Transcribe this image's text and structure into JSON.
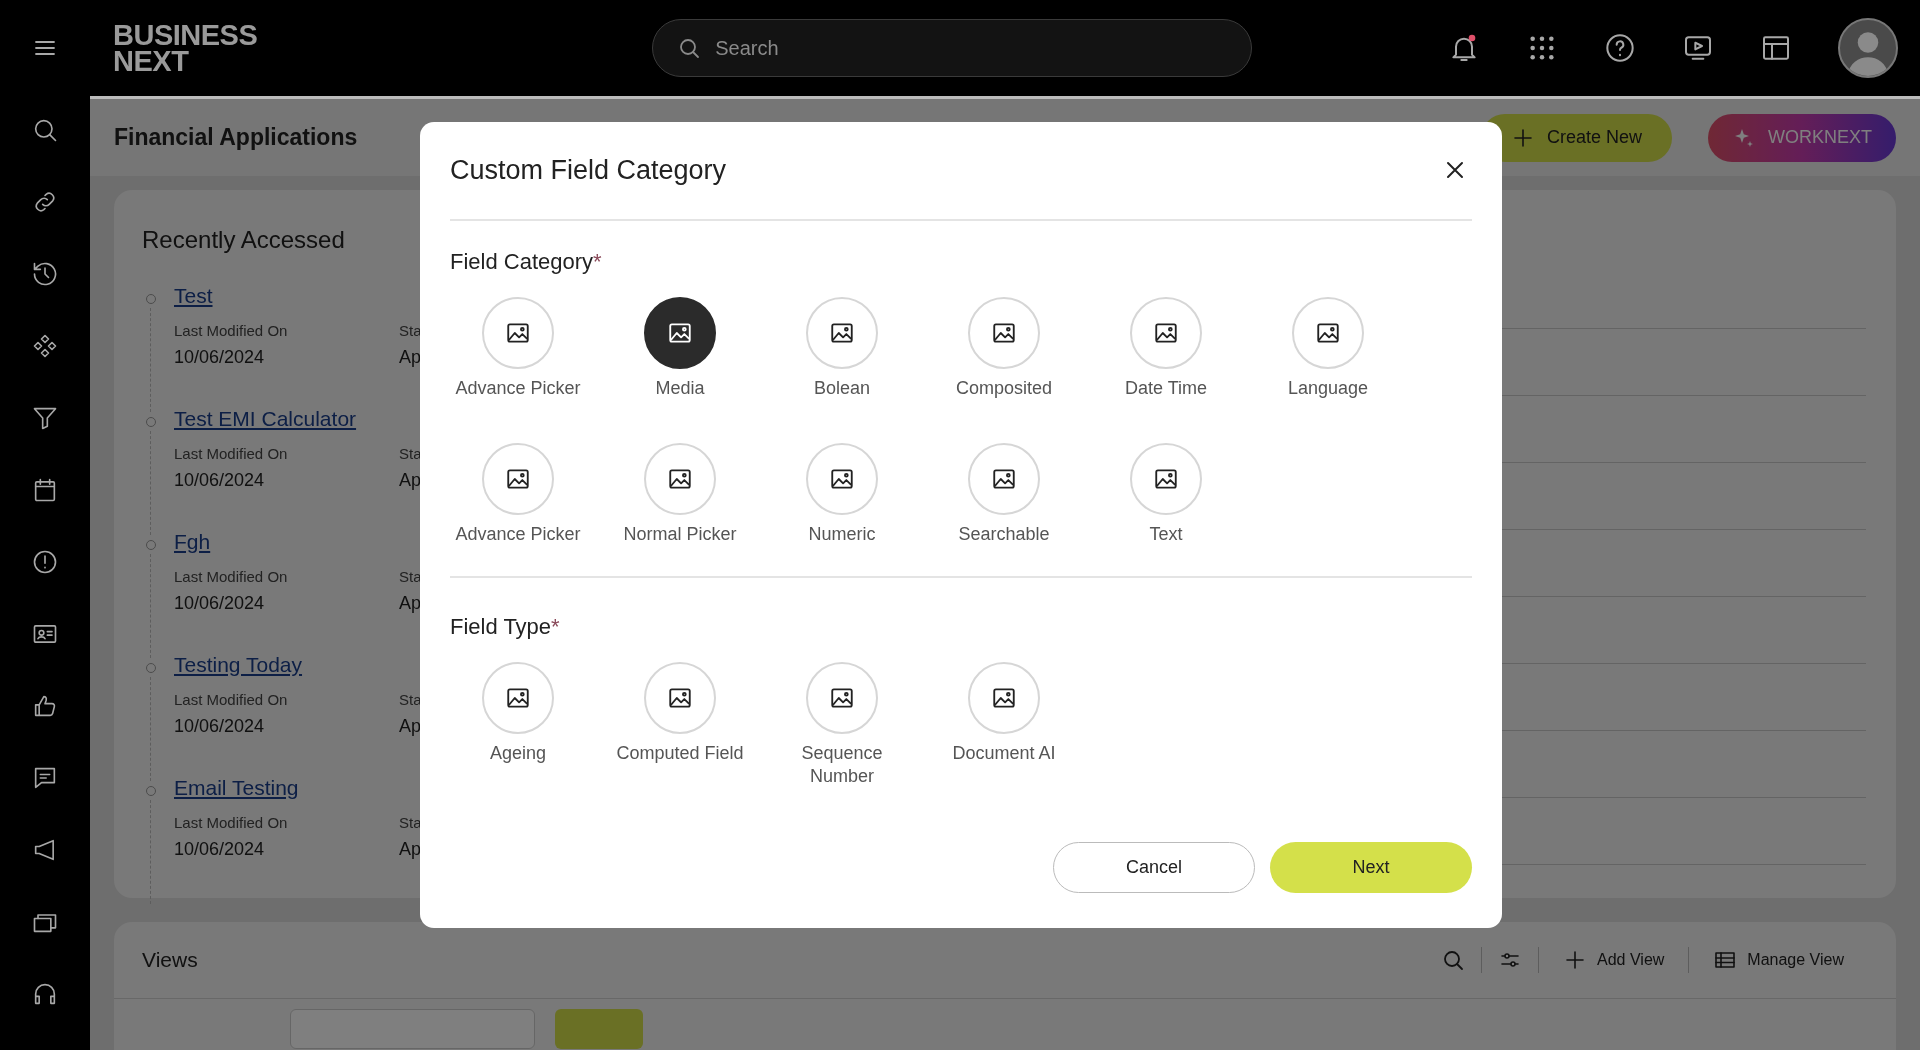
{
  "topbar": {
    "logo": [
      "BUSINESS",
      "NEXT"
    ],
    "search": {
      "placeholder": "Search"
    }
  },
  "page": {
    "title": "Financial Applications",
    "actions": [
      {
        "label": "Create New",
        "kind": "create"
      },
      {
        "label": "WORKNEXT",
        "kind": "ai"
      }
    ]
  },
  "recently_accessed": {
    "title": "Recently Accessed",
    "items": [
      {
        "name": "Test",
        "label": "Last Modified On",
        "date": "10/06/2024",
        "column_2_label": "Sta",
        "column_2_value": "Ap"
      },
      {
        "name": "Test EMI Calculator",
        "label": "Last Modified On",
        "date": "10/06/2024",
        "column_2_label": "Sta",
        "column_2_value": "Ap"
      },
      {
        "name": "Fgh",
        "label": "Last Modified On",
        "date": "10/06/2024",
        "column_2_label": "Sta",
        "column_2_value": "Ap"
      },
      {
        "name": "Testing Today",
        "label": "Last Modified On",
        "date": "10/06/2024",
        "column_2_label": "Sta",
        "column_2_value": "Ap"
      },
      {
        "name": "Email Testing",
        "label": "Last Modified On",
        "date": "10/06/2024",
        "column_2_label": "Sta",
        "column_2_value": "Ap"
      }
    ]
  },
  "views": {
    "title": "Views",
    "actions": [
      {
        "label": "Add View",
        "kind": "add"
      },
      {
        "label": "Manage View",
        "kind": "manage"
      }
    ]
  },
  "dialog": {
    "title": "Custom Field Category",
    "sections": [
      {
        "title": "Field Category",
        "required_mark": "*",
        "options": [
          {
            "label": "Advance Picker",
            "selected": false
          },
          {
            "label": "Media",
            "selected": true
          },
          {
            "label": "Bolean",
            "selected": false
          },
          {
            "label": "Composited",
            "selected": false
          },
          {
            "label": "Date Time",
            "selected": false
          },
          {
            "label": "Language",
            "selected": false
          },
          {
            "label": "Advance Picker",
            "selected": false
          },
          {
            "label": "Normal Picker",
            "selected": false
          },
          {
            "label": "Numeric",
            "selected": false
          },
          {
            "label": "Searchable",
            "selected": false
          },
          {
            "label": "Text",
            "selected": false
          }
        ]
      },
      {
        "title": "Field Type",
        "required_mark": "*",
        "options": [
          {
            "label": "Ageing",
            "selected": false
          },
          {
            "label": "Computed Field",
            "selected": false
          },
          {
            "label": "Sequence Number",
            "selected": false
          },
          {
            "label": "Document AI",
            "selected": false
          }
        ]
      }
    ],
    "buttons": [
      {
        "label": "Cancel",
        "kind": "secondary"
      },
      {
        "label": "Next",
        "kind": "primary"
      }
    ]
  }
}
